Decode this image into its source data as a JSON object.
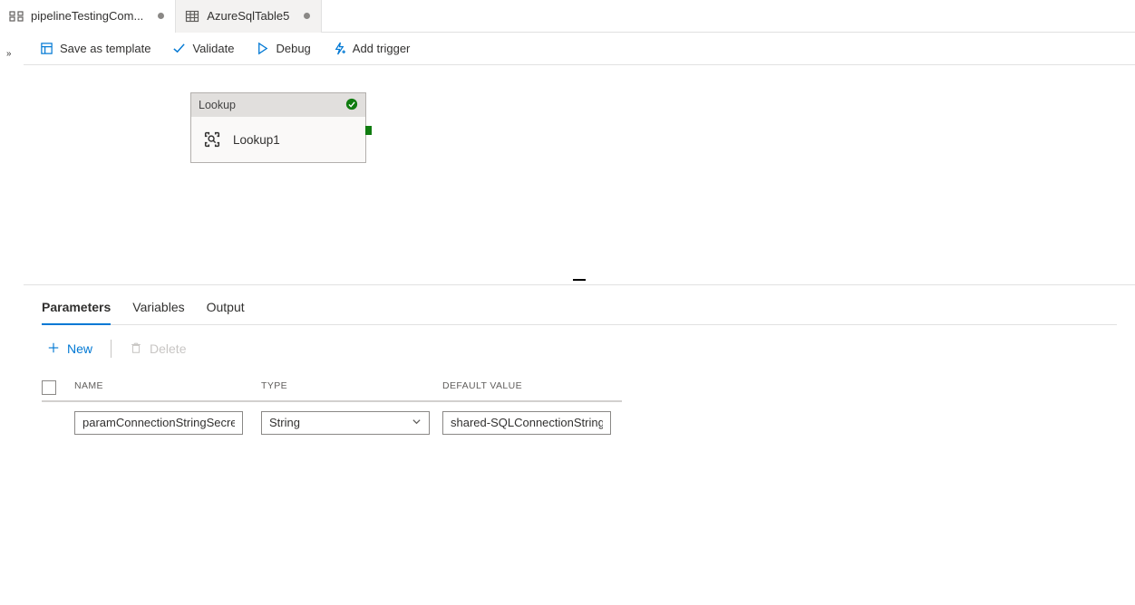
{
  "tabs": [
    {
      "label": "pipelineTestingCom...",
      "icon": "pipeline"
    },
    {
      "label": "AzureSqlTable5",
      "icon": "table"
    }
  ],
  "toolbar": {
    "save_template": "Save as template",
    "validate": "Validate",
    "debug": "Debug",
    "add_trigger": "Add trigger"
  },
  "canvas": {
    "activity_type": "Lookup",
    "activity_name": "Lookup1"
  },
  "bottom_tabs": {
    "parameters": "Parameters",
    "variables": "Variables",
    "output": "Output"
  },
  "actions": {
    "new": "New",
    "delete": "Delete"
  },
  "columns": {
    "name": "NAME",
    "type": "TYPE",
    "default_value": "DEFAULT VALUE"
  },
  "params": [
    {
      "name": "paramConnectionStringSecret",
      "type": "String",
      "default_value": "shared-SQLConnectionString-k"
    }
  ]
}
